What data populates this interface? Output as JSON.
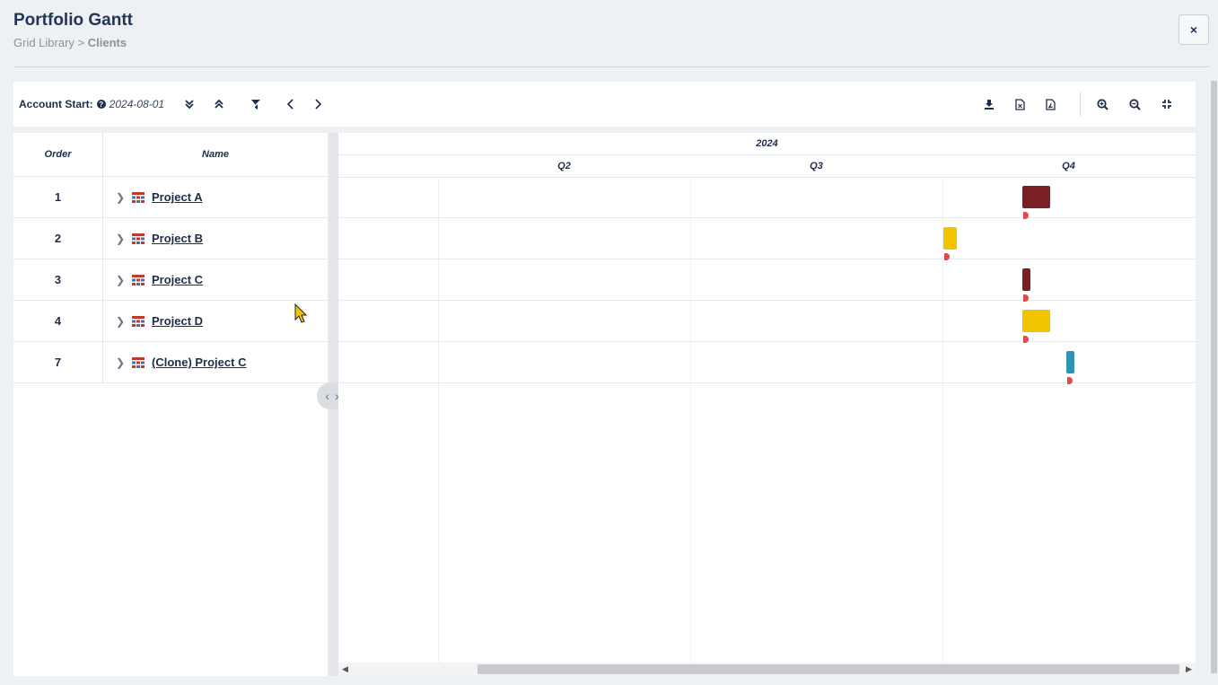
{
  "header": {
    "title": "Portfolio Gantt",
    "breadcrumb_root": "Grid Library",
    "breadcrumb_sep": " > ",
    "breadcrumb_current": "Clients",
    "close_label": "×"
  },
  "toolbar": {
    "account_label": "Account Start:",
    "account_help": "?",
    "account_value": "2024-08-01",
    "icons": [
      "expand-all-icon",
      "collapse-all-icon",
      "clear-filter-icon",
      "prev-icon",
      "next-icon",
      "download-icon",
      "export-excel-icon",
      "export-pdf-icon",
      "zoom-in-icon",
      "zoom-out-icon",
      "fit-screen-icon"
    ]
  },
  "grid": {
    "columns": {
      "order": "Order",
      "name": "Name"
    },
    "rows": [
      {
        "order": "1",
        "name": "Project A"
      },
      {
        "order": "2",
        "name": "Project B"
      },
      {
        "order": "3",
        "name": "Project C"
      },
      {
        "order": "4",
        "name": "Project D"
      },
      {
        "order": "7",
        "name": "(Clone) Project C"
      }
    ]
  },
  "timeline": {
    "year": "2024",
    "quarters": [
      "Q2",
      "Q3",
      "Q4"
    ],
    "bars": [
      {
        "row": 0,
        "color": "#7a1f24"
      },
      {
        "row": 1,
        "color": "#f2c400"
      },
      {
        "row": 2,
        "color": "#7a1f24"
      },
      {
        "row": 3,
        "color": "#f2c400"
      },
      {
        "row": 4,
        "color": "#2e93b4"
      }
    ]
  },
  "colors": {
    "accent": "#233556",
    "marker": "#e04b4b"
  }
}
